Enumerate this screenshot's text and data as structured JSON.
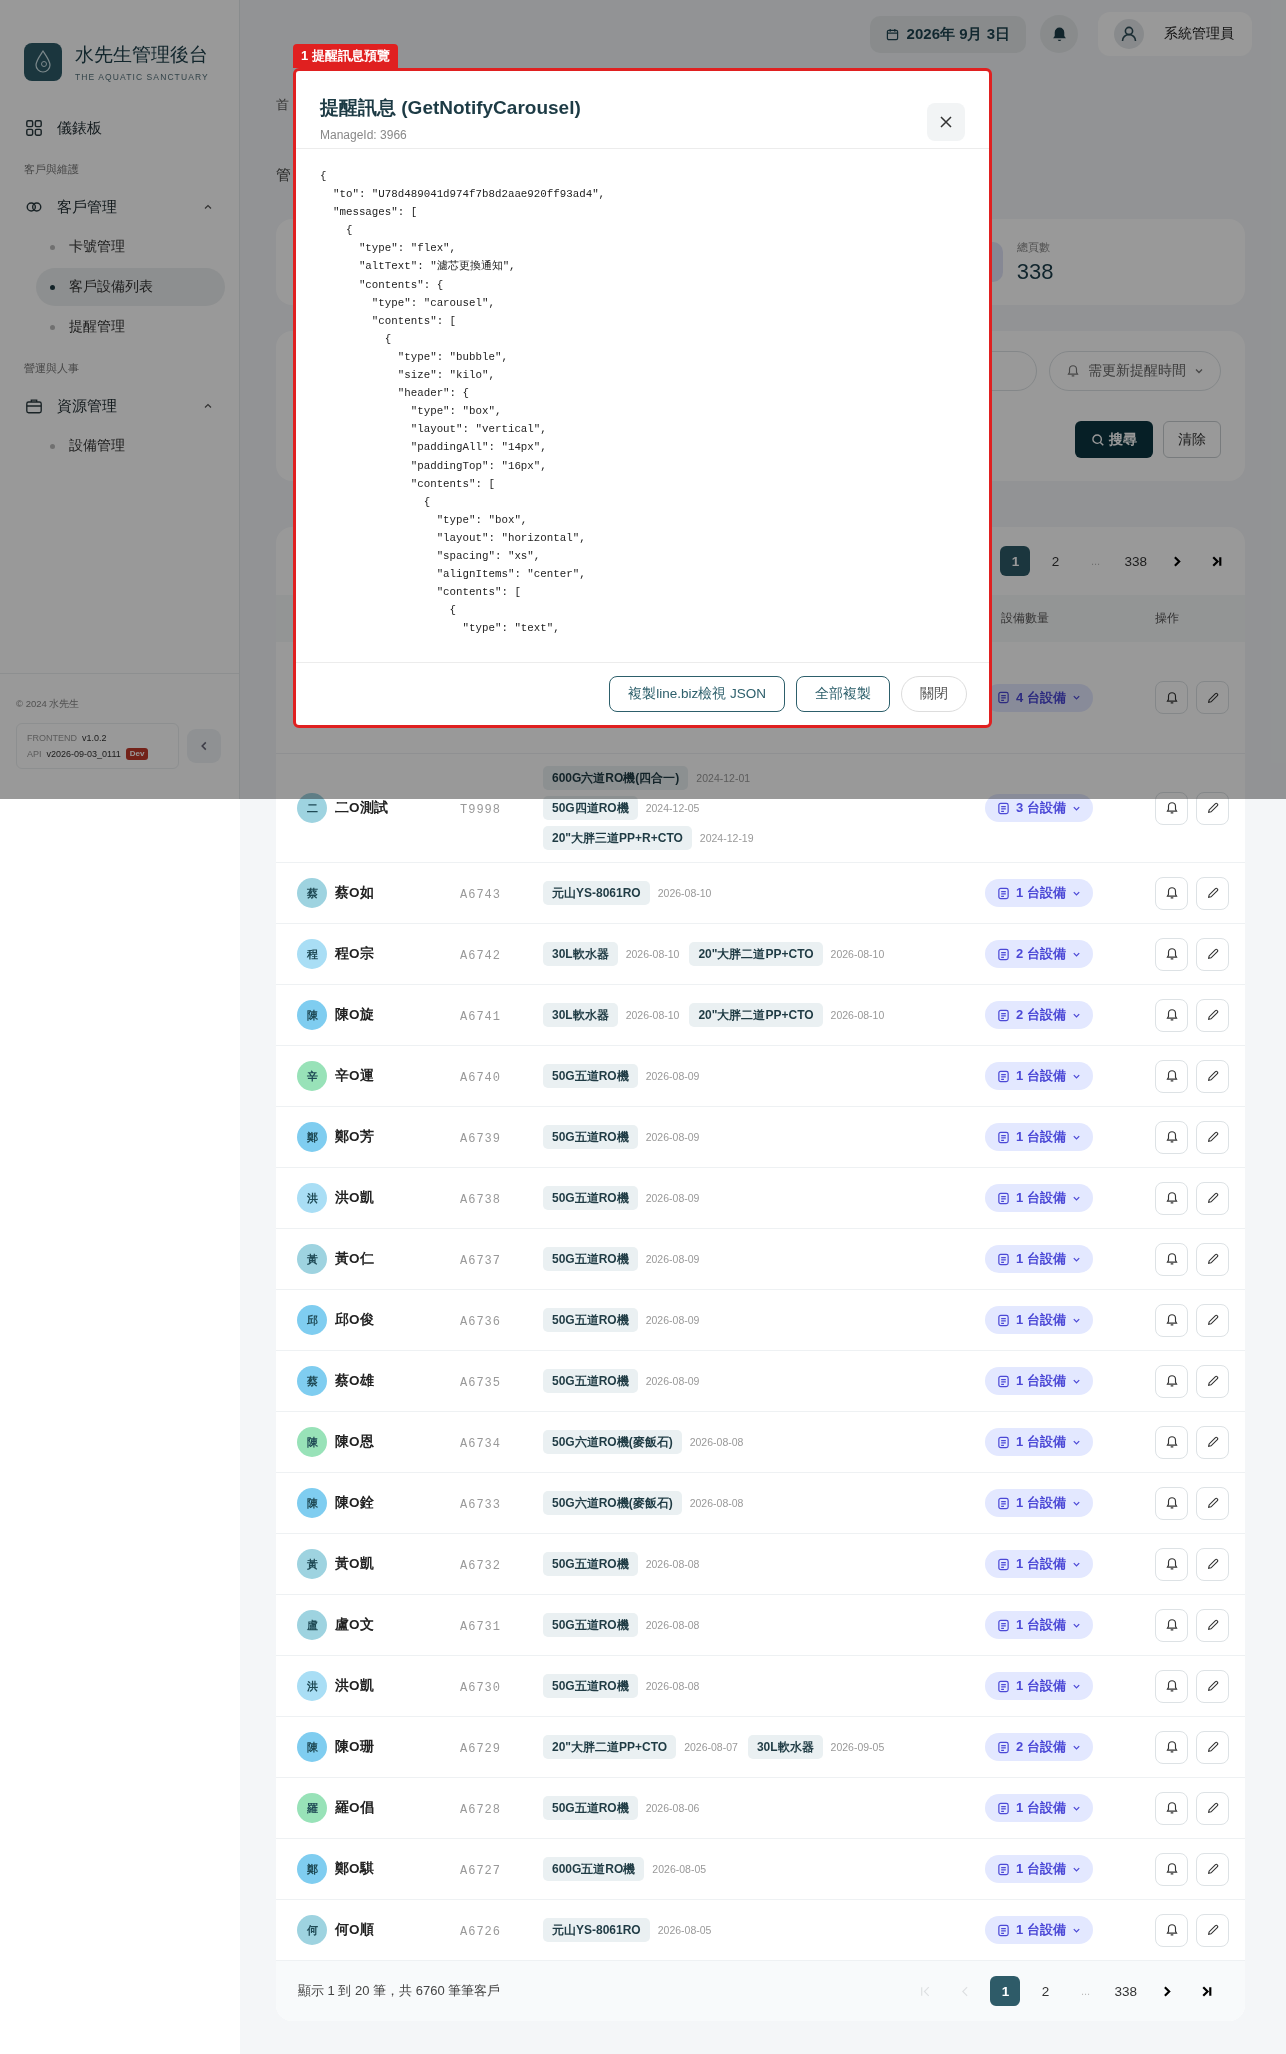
{
  "topbar": {
    "date": "2026年 9月 3日",
    "user": "系統管理員"
  },
  "sidebar": {
    "brand": {
      "title": "水先生管理後台",
      "subtitle": "THE AQUATIC SANCTUARY"
    },
    "dashboard": {
      "label": "儀錶板",
      "selected": false
    },
    "sections": [
      {
        "title": "客戶與維護",
        "groups": [
          {
            "label": "客戶管理",
            "expanded": true,
            "children": [
              {
                "label": "卡號管理",
                "selected": false
              },
              {
                "label": "客戶設備列表",
                "selected": true
              },
              {
                "label": "提醒管理",
                "selected": false
              }
            ]
          }
        ]
      },
      {
        "title": "營運與人事",
        "groups": [
          {
            "label": "資源管理",
            "expanded": true,
            "children": [
              {
                "label": "設備管理",
                "selected": false
              }
            ]
          }
        ]
      }
    ],
    "copyright": "© 2024 水先生",
    "versions": [
      {
        "label": "FRONTEND",
        "value": "v1.0.2"
      },
      {
        "label": "API",
        "value": "v2026-09-03_0111",
        "badge": "Dev"
      }
    ]
  },
  "page": {
    "breadcrumb": "首",
    "subtitle": "管"
  },
  "stats": [
    {
      "label": "總頁數",
      "value": "338"
    }
  ],
  "filters": {
    "reminder_filter": "需更新提醒時間",
    "buttons": [
      {
        "label": "搜尋",
        "kind": "primary"
      },
      {
        "label": "清除",
        "kind": "secondary"
      }
    ]
  },
  "table": {
    "pagination_top": [
      {
        "kind": "page",
        "label": "1",
        "selected": true
      },
      {
        "kind": "page",
        "label": "2",
        "selected": false
      },
      {
        "kind": "ellipsis",
        "label": "..."
      },
      {
        "kind": "page",
        "label": "338",
        "selected": false
      },
      {
        "kind": "next",
        "disabled": false
      },
      {
        "kind": "last",
        "disabled": false
      }
    ],
    "columns": [
      "設備數量",
      "操作"
    ],
    "rows": [
      {
        "device_count": "4 台設備"
      },
      {
        "initial": "二",
        "name": "二O測試",
        "code": "T9998",
        "color": "#9ed3e0",
        "device_count": "3 台設備",
        "equipment_lines": [
          [
            {
              "model": "600G六道RO機(四合一)",
              "date": "2024-12-01"
            }
          ],
          [
            {
              "model": "50G四道RO機",
              "date": "2024-12-05"
            }
          ],
          [
            {
              "model": "20\"大胖三道PP+R+CTO",
              "date": "2024-12-19"
            }
          ]
        ]
      },
      {
        "initial": "蔡",
        "name": "蔡O如",
        "code": "A6743",
        "color": "#9ed3e0",
        "device_count": "1 台設備",
        "equipment_lines": [
          [
            {
              "model": "元山YS-8061RO",
              "date": "2026-08-10"
            }
          ]
        ]
      },
      {
        "initial": "程",
        "name": "程O宗",
        "code": "A6742",
        "color": "#a9def5",
        "device_count": "2 台設備",
        "equipment_lines": [
          [
            {
              "model": "30L軟水器",
              "date": "2026-08-10"
            },
            {
              "model": "20\"大胖二道PP+CTO",
              "date": "2026-08-10"
            }
          ]
        ]
      },
      {
        "initial": "陳",
        "name": "陳O旋",
        "code": "A6741",
        "color": "#7fcdf0",
        "device_count": "2 台設備",
        "equipment_lines": [
          [
            {
              "model": "30L軟水器",
              "date": "2026-08-10"
            },
            {
              "model": "20\"大胖二道PP+CTO",
              "date": "2026-08-10"
            }
          ]
        ]
      },
      {
        "initial": "辛",
        "name": "辛O運",
        "code": "A6740",
        "color": "#98e2b8",
        "device_count": "1 台設備",
        "equipment_lines": [
          [
            {
              "model": "50G五道RO機",
              "date": "2026-08-09"
            }
          ]
        ]
      },
      {
        "initial": "鄭",
        "name": "鄭O芳",
        "code": "A6739",
        "color": "#7fcdf0",
        "device_count": "1 台設備",
        "equipment_lines": [
          [
            {
              "model": "50G五道RO機",
              "date": "2026-08-09"
            }
          ]
        ]
      },
      {
        "initial": "洪",
        "name": "洪O凱",
        "code": "A6738",
        "color": "#a9def5",
        "device_count": "1 台設備",
        "equipment_lines": [
          [
            {
              "model": "50G五道RO機",
              "date": "2026-08-09"
            }
          ]
        ]
      },
      {
        "initial": "黃",
        "name": "黃O仁",
        "code": "A6737",
        "color": "#9ed3e0",
        "device_count": "1 台設備",
        "equipment_lines": [
          [
            {
              "model": "50G五道RO機",
              "date": "2026-08-09"
            }
          ]
        ]
      },
      {
        "initial": "邱",
        "name": "邱O俊",
        "code": "A6736",
        "color": "#7fcdf0",
        "device_count": "1 台設備",
        "equipment_lines": [
          [
            {
              "model": "50G五道RO機",
              "date": "2026-08-09"
            }
          ]
        ]
      },
      {
        "initial": "蔡",
        "name": "蔡O雄",
        "code": "A6735",
        "color": "#7fcdf0",
        "device_count": "1 台設備",
        "equipment_lines": [
          [
            {
              "model": "50G五道RO機",
              "date": "2026-08-09"
            }
          ]
        ]
      },
      {
        "initial": "陳",
        "name": "陳O恩",
        "code": "A6734",
        "color": "#98e2b8",
        "device_count": "1 台設備",
        "equipment_lines": [
          [
            {
              "model": "50G六道RO機(麥飯石)",
              "date": "2026-08-08"
            }
          ]
        ]
      },
      {
        "initial": "陳",
        "name": "陳O銓",
        "code": "A6733",
        "color": "#7fcdf0",
        "device_count": "1 台設備",
        "equipment_lines": [
          [
            {
              "model": "50G六道RO機(麥飯石)",
              "date": "2026-08-08"
            }
          ]
        ]
      },
      {
        "initial": "黃",
        "name": "黃O凱",
        "code": "A6732",
        "color": "#9ed3e0",
        "device_count": "1 台設備",
        "equipment_lines": [
          [
            {
              "model": "50G五道RO機",
              "date": "2026-08-08"
            }
          ]
        ]
      },
      {
        "initial": "盧",
        "name": "盧O文",
        "code": "A6731",
        "color": "#9ed3e0",
        "device_count": "1 台設備",
        "equipment_lines": [
          [
            {
              "model": "50G五道RO機",
              "date": "2026-08-08"
            }
          ]
        ]
      },
      {
        "initial": "洪",
        "name": "洪O凱",
        "code": "A6730",
        "color": "#a9def5",
        "device_count": "1 台設備",
        "equipment_lines": [
          [
            {
              "model": "50G五道RO機",
              "date": "2026-08-08"
            }
          ]
        ]
      },
      {
        "initial": "陳",
        "name": "陳O珊",
        "code": "A6729",
        "color": "#7fcdf0",
        "device_count": "2 台設備",
        "equipment_lines": [
          [
            {
              "model": "20\"大胖二道PP+CTO",
              "date": "2026-08-07"
            },
            {
              "model": "30L軟水器",
              "date": "2026-09-05"
            }
          ]
        ]
      },
      {
        "initial": "羅",
        "name": "羅O倡",
        "code": "A6728",
        "color": "#98e2b8",
        "device_count": "1 台設備",
        "equipment_lines": [
          [
            {
              "model": "50G五道RO機",
              "date": "2026-08-06"
            }
          ]
        ]
      },
      {
        "initial": "鄭",
        "name": "鄭O騏",
        "code": "A6727",
        "color": "#7fcdf0",
        "device_count": "1 台設備",
        "equipment_lines": [
          [
            {
              "model": "600G五道RO機",
              "date": "2026-08-05"
            }
          ]
        ]
      },
      {
        "initial": "何",
        "name": "何O順",
        "code": "A6726",
        "color": "#9ed3e0",
        "device_count": "1 台設備",
        "equipment_lines": [
          [
            {
              "model": "元山YS-8061RO",
              "date": "2026-08-05"
            }
          ]
        ]
      }
    ],
    "summary": "顯示 1 到 20 筆，共 6760 筆筆客戶",
    "pagination_bottom": [
      {
        "kind": "first",
        "disabled": true
      },
      {
        "kind": "prev",
        "disabled": true
      },
      {
        "kind": "page",
        "label": "1",
        "selected": true
      },
      {
        "kind": "page",
        "label": "2",
        "selected": false
      },
      {
        "kind": "ellipsis",
        "label": "..."
      },
      {
        "kind": "page",
        "label": "338",
        "selected": false
      },
      {
        "kind": "next",
        "disabled": false
      },
      {
        "kind": "last",
        "disabled": false
      }
    ]
  },
  "modal": {
    "tag": "1 提醒訊息預覽",
    "title": "提醒訊息 (GetNotifyCarousel)",
    "subtitle": "ManageId: 3966",
    "code_lines": [
      "{",
      "  \"to\": \"U78d489041d974f7b8d2aae920ff93ad4\",",
      "  \"messages\": [",
      "    {",
      "      \"type\": \"flex\",",
      "      \"altText\": \"濾芯更換通知\",",
      "      \"contents\": {",
      "        \"type\": \"carousel\",",
      "        \"contents\": [",
      "          {",
      "            \"type\": \"bubble\",",
      "            \"size\": \"kilo\",",
      "            \"header\": {",
      "              \"type\": \"box\",",
      "              \"layout\": \"vertical\",",
      "              \"paddingAll\": \"14px\",",
      "              \"paddingTop\": \"16px\",",
      "              \"contents\": [",
      "                {",
      "                  \"type\": \"box\",",
      "                  \"layout\": \"horizontal\",",
      "                  \"spacing\": \"xs\",",
      "                  \"alignItems\": \"center\",",
      "                  \"contents\": [",
      "                    {",
      "                      \"type\": \"text\","
    ],
    "buttons": [
      {
        "label": "複製line.biz檢視 JSON",
        "kind": "outline"
      },
      {
        "label": "全部複製",
        "kind": "outline"
      },
      {
        "label": "關閉",
        "kind": "plain"
      }
    ]
  }
}
